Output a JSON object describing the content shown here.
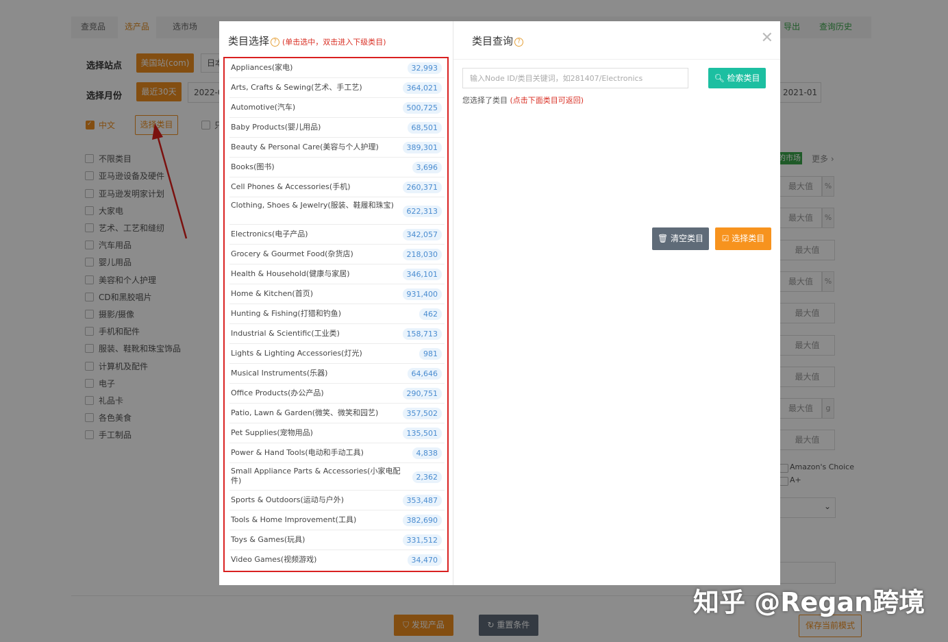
{
  "background": {
    "tabs": [
      "查竞品",
      "选产品",
      "选市场"
    ],
    "tabs_right": [
      "导出",
      "查询历史"
    ],
    "site_label": "选择站点",
    "site_selected": "美国站(com)",
    "site_other": "日本",
    "month_label": "选择月份",
    "month_selected": "最近30天",
    "month_start": "2022-0",
    "month_end": "2021-01",
    "lang_option": "中文",
    "choose_category_btn": "选择类目",
    "only_label": "只",
    "category_list": [
      "不限类目",
      "亚马逊设备及硬件",
      "亚马逊发明家计划",
      "大家电",
      "艺术、工艺和缝纫",
      "汽车用品",
      "婴儿用品",
      "美容和个人护理",
      "CD和黑胶唱片",
      "摄影/摄像",
      "手机和配件",
      "服装、鞋靴和珠宝饰品",
      "计算机及配件",
      "电子",
      "礼品卡",
      "各色美食",
      "手工制品"
    ],
    "market_tag": "的市场",
    "more_label": "更多 ›",
    "max_label": "最大值",
    "percent_unit": "%",
    "gram_unit": "g",
    "amazon_choice": "Amazon's Choice",
    "aplus": "A+",
    "discover_btn": "发现产品",
    "reset_btn": "重置条件",
    "save_mode_btn": "保存当前模式"
  },
  "modal": {
    "left_title": "类目选择",
    "left_hint": "(单击选中，双击进入下级类目)",
    "right_title": "类目查询",
    "search_placeholder": "输入Node ID/类目关键词，如281407/Electronics",
    "search_button": "检索类目",
    "selected_prefix": "您选择了类目",
    "selected_hint": "(点击下面类目可返回)",
    "clear_button": "清空类目",
    "choose_button": "选择类目",
    "categories": [
      {
        "name": "Appliances(家电)",
        "count": "32,993"
      },
      {
        "name": "Arts, Crafts & Sewing(艺术、手工艺)",
        "count": "364,021"
      },
      {
        "name": "Automotive(汽车)",
        "count": "500,725"
      },
      {
        "name": "Baby Products(婴儿用品)",
        "count": "68,501"
      },
      {
        "name": "Beauty & Personal Care(美容与个人护理)",
        "count": "389,301"
      },
      {
        "name": "Books(图书)",
        "count": "3,696"
      },
      {
        "name": "Cell Phones & Accessories(手机)",
        "count": "260,371"
      },
      {
        "name": "Clothing, Shoes & Jewelry(服装、鞋履和珠宝)",
        "count": "622,313"
      },
      {
        "name": "Electronics(电子产品)",
        "count": "342,057"
      },
      {
        "name": "Grocery & Gourmet Food(杂货店)",
        "count": "218,030"
      },
      {
        "name": "Health & Household(健康与家居)",
        "count": "346,101"
      },
      {
        "name": "Home & Kitchen(首页)",
        "count": "931,400"
      },
      {
        "name": "Hunting & Fishing(打猎和钓鱼)",
        "count": "462"
      },
      {
        "name": "Industrial & Scientific(工业类)",
        "count": "158,713"
      },
      {
        "name": "Lights & Lighting Accessories(灯光)",
        "count": "981"
      },
      {
        "name": "Musical Instruments(乐器)",
        "count": "64,646"
      },
      {
        "name": "Office Products(办公产品)",
        "count": "290,751"
      },
      {
        "name": "Patio, Lawn & Garden(微笑、微笑和园艺)",
        "count": "357,502"
      },
      {
        "name": "Pet Supplies(宠物用品)",
        "count": "135,501"
      },
      {
        "name": "Power & Hand Tools(电动和手动工具)",
        "count": "4,838"
      },
      {
        "name": "Small Appliance Parts & Accessories(小家电配件)",
        "count": "2,362"
      },
      {
        "name": "Sports & Outdoors(运动与户外)",
        "count": "353,487"
      },
      {
        "name": "Tools & Home Improvement(工具)",
        "count": "382,690"
      },
      {
        "name": "Toys & Games(玩具)",
        "count": "331,512"
      },
      {
        "name": "Video Games(视频游戏)",
        "count": "34,470"
      }
    ]
  },
  "watermark": "知乎 @Regan跨境",
  "colors": {
    "accent": "#ef8f1f",
    "teal": "#1cbfa1",
    "highlight_border": "#d92020",
    "count_text": "#4a8cd0"
  }
}
